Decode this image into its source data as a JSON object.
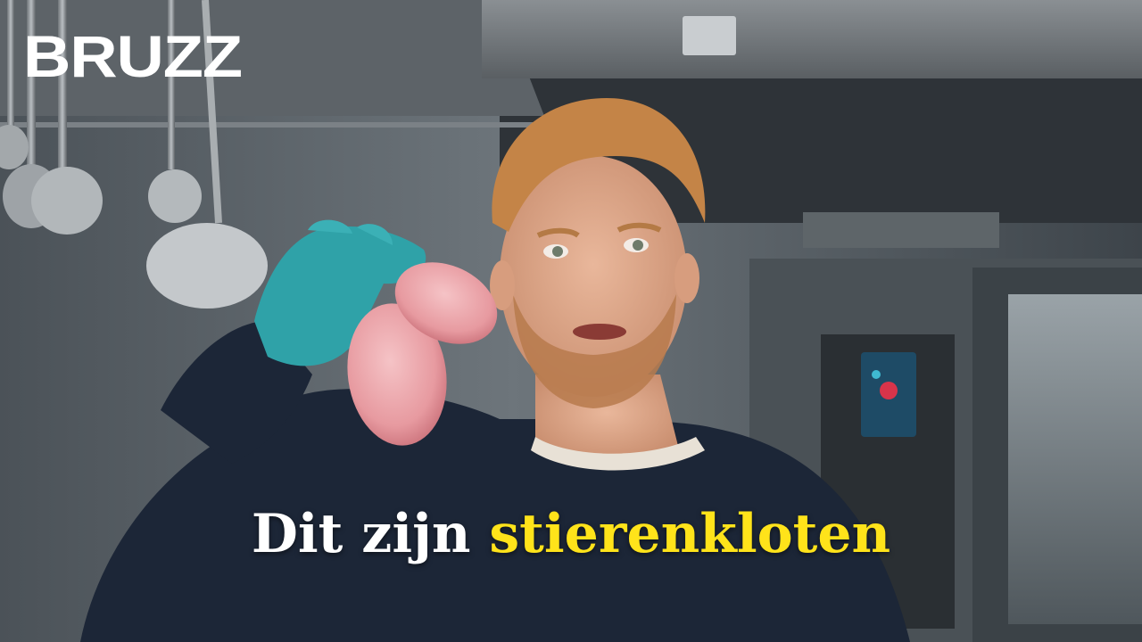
{
  "brand": {
    "logo_text": "BRUZZ"
  },
  "caption": {
    "part1": "Dit zijn",
    "part2": "stierenkloten",
    "color_white": "#ffffff",
    "color_highlight": "#ffe31a"
  },
  "scene": {
    "subject": "man in dark navy sweater with blond hair and beard",
    "held_object": "pink raw bull testicles in blue-green gloved hand",
    "background": "stainless steel professional kitchen with hanging ladles and combi oven"
  }
}
